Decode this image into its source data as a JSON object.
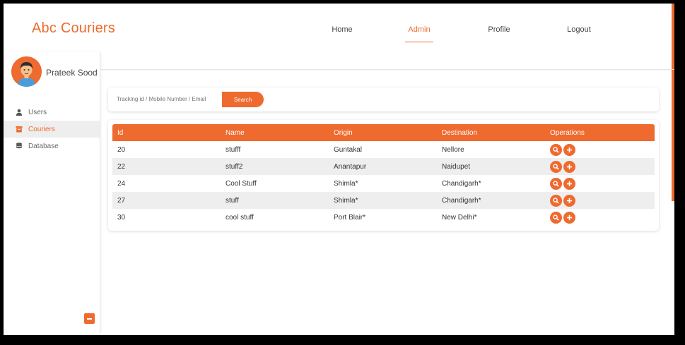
{
  "brand": {
    "title": "Abc Couriers"
  },
  "nav": {
    "items": [
      {
        "label": "Home",
        "active": false
      },
      {
        "label": "Admin",
        "active": true
      },
      {
        "label": "Profile",
        "active": false
      },
      {
        "label": "Logout",
        "active": false
      }
    ]
  },
  "sidebar": {
    "profile_name": "Prateek Sood",
    "items": [
      {
        "label": "Users",
        "icon": "user-icon",
        "active": false
      },
      {
        "label": "Couriers",
        "icon": "box-icon",
        "active": true
      },
      {
        "label": "Database",
        "icon": "database-icon",
        "active": false
      }
    ],
    "collapse_icon": "minus-icon"
  },
  "search": {
    "placeholder": "Tracking id / Mobile Number / Email",
    "value": "",
    "button_label": "Search"
  },
  "table": {
    "headers": [
      "Id",
      "Name",
      "Origin",
      "Destination",
      "Operations"
    ],
    "rows": [
      [
        "20",
        "stufff",
        "Guntakal",
        "Nellore"
      ],
      [
        "22",
        "stuff2",
        "Anantapur",
        "Naidupet"
      ],
      [
        "24",
        "Cool Stuff",
        "Shimla*",
        "Chandigarh*"
      ],
      [
        "27",
        "stuff",
        "Shimla*",
        "Chandigarh*"
      ],
      [
        "30",
        "cool stuff",
        "Port Blair*",
        "New Delhi*"
      ]
    ],
    "operation_icons": [
      "search-icon",
      "plus-icon"
    ]
  },
  "colors": {
    "accent": "#ee6a2f",
    "stripe": "#eeeeee"
  }
}
